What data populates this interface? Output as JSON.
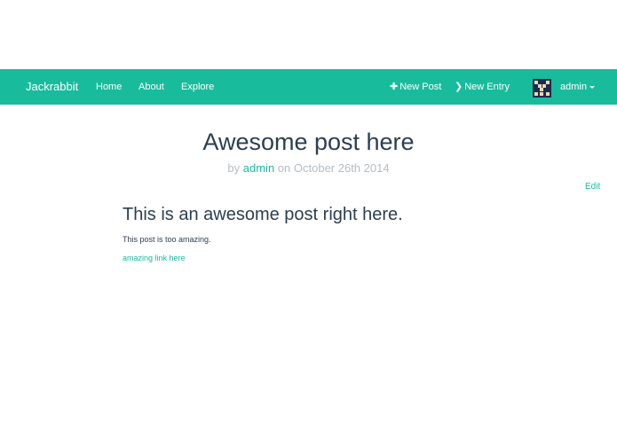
{
  "navbar": {
    "brand": "Jackrabbit",
    "links": [
      "Home",
      "About",
      "Explore"
    ],
    "new_post": "New Post",
    "new_entry": "New Entry",
    "user": "admin",
    "accent_color": "#18bc9c"
  },
  "post": {
    "title": "Awesome post here",
    "by_label": "by",
    "author": "admin",
    "date": "on October 26th 2014",
    "edit_label": "Edit"
  },
  "content": {
    "heading": "This is an awesome post right here.",
    "text": "This post is too amazing.",
    "link": "amazing link here"
  }
}
